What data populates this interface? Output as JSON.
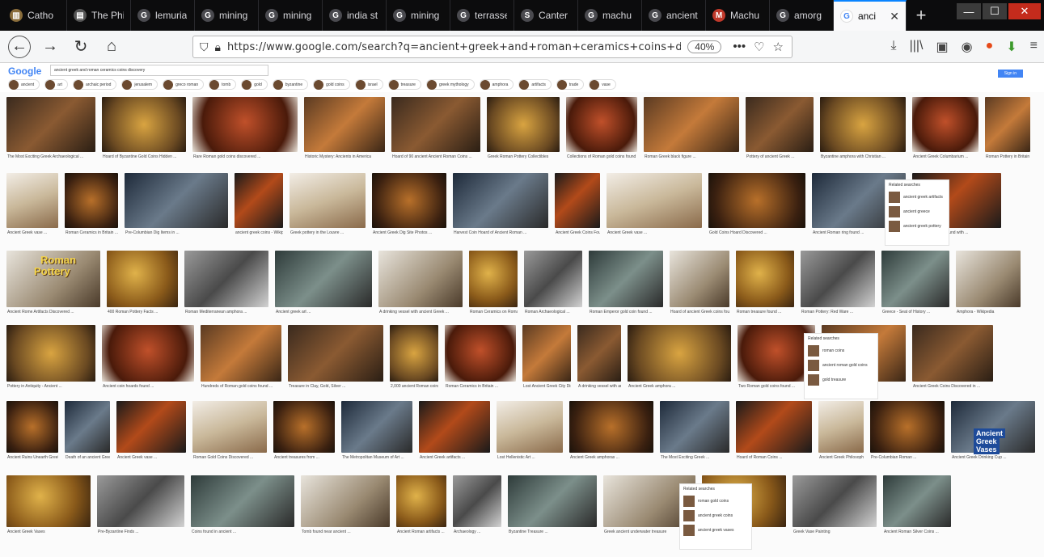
{
  "browser": {
    "tabs": [
      {
        "title": "Catho",
        "icon": "library-icon",
        "color": "#8a6d3b",
        "glyph": "▥"
      },
      {
        "title": "The Phi",
        "icon": "page-icon",
        "color": "#555555",
        "glyph": "▤"
      },
      {
        "title": "lemuria",
        "icon": "google-icon",
        "color": "#4a4a4f",
        "glyph": "G"
      },
      {
        "title": "mining",
        "icon": "google-icon",
        "color": "#4a4a4f",
        "glyph": "G"
      },
      {
        "title": "mining",
        "icon": "google-icon",
        "color": "#4a4a4f",
        "glyph": "G"
      },
      {
        "title": "india st",
        "icon": "google-icon",
        "color": "#4a4a4f",
        "glyph": "G"
      },
      {
        "title": "mining",
        "icon": "google-icon",
        "color": "#4a4a4f",
        "glyph": "G"
      },
      {
        "title": "terrasse",
        "icon": "google-icon",
        "color": "#4a4a4f",
        "glyph": "G"
      },
      {
        "title": "Canter",
        "icon": "s-icon",
        "color": "#4a4a4f",
        "glyph": "S"
      },
      {
        "title": "machu",
        "icon": "google-icon",
        "color": "#4a4a4f",
        "glyph": "G"
      },
      {
        "title": "ancient",
        "icon": "google-icon",
        "color": "#4a4a4f",
        "glyph": "G"
      },
      {
        "title": "Machu",
        "icon": "site-icon",
        "color": "#c0392b",
        "glyph": "M"
      },
      {
        "title": "amorg",
        "icon": "google-icon",
        "color": "#4a4a4f",
        "glyph": "G"
      }
    ],
    "active_tab": {
      "title": "anci",
      "icon": "google-icon"
    },
    "new_tab_label": "+",
    "url": "https://www.google.com/search?q=ancient+greek+and+roman+ceramics+coins+dis",
    "zoom": "40%"
  },
  "google": {
    "logo": "Google",
    "query": "ancient greek and roman ceramics coins discovery",
    "signin": "Sign in",
    "chips": [
      "ancient",
      "art",
      "archaic period",
      "jerusalem",
      "greco roman",
      "tomb",
      "gold",
      "byzantine",
      "gold coins",
      "israel",
      "treasure",
      "greek mythology",
      "amphora",
      "artifacts",
      "trade",
      "vase"
    ]
  },
  "results": {
    "captions": [
      "The Most Exciting Greek Archaeological ...",
      "Hoard of Byzantine Gold Coins Hidden ...",
      "Rare Roman gold coins discovered ...",
      "Historic Mystery: Ancients in America",
      "Hoard of 90 ancient Ancient Roman Coins ...",
      "Greek Roman Pottery Collectibles",
      "Collections of Roman gold coins found in ...",
      "Roman Greek black figure ...",
      "Pottery of ancient Greek ...",
      "Byzantine amphora with Christian ...",
      "Ancient Greek Columbarium ...",
      "Roman Pottery in Britain ...",
      "Ancient Greek vase ...",
      "Roman Ceramics in Britain ...",
      "Pre-Columbian Dig Items in ...",
      "ancient greek coins - Wikipedia",
      "Greek pottery in the Louvre ...",
      "Ancient Greek Dig Site Photos ...",
      "Harvest Coin Hoard of Ancient Roman ...",
      "Ancient Greek Coins Found ...",
      "Ancient Greek vase ...",
      "Gold Coins Hoard Discovered ...",
      "Ancient Roman ring found ...",
      "Gold Roman coin found with ...",
      "Ancient Rome Artifacts Discovered ...",
      "400 Roman Pottery Facts ...",
      "Roman Mediterranean amphora ...",
      "Ancient greek art ...",
      "A drinking vessel with ancient Greek ...",
      "Roman Ceramics on Roman Ceramics ...",
      "Roman Archaeological ...",
      "Roman Emperor gold coin found ...",
      "Hoard of ancient Greek coins found ...",
      "Roman treasure found ...",
      "Roman Pottery: Red Ware ...",
      "Greece - Seat of History ...",
      "Amphora - Wikipedia",
      "Pottery in Antiquity - Ancient ...",
      "Ancient coin hoards found ...",
      "Hundreds of Roman gold coins found ...",
      "Treasure in Clay, Gold, Silver ...",
      "2,000 ancient Roman coins discovered ...",
      "Roman Ceramics in Britain ...",
      "Lost Ancient Greek City Discovered ...",
      "A drinking vessel with ancient ...",
      "Ancient Greek amphora ...",
      "Two Roman gold coins found ...",
      "Pottery of ancient Greece ...",
      "Ancient Greek Coins Discovered in ...",
      "Ancient Ruins Unearth Greek ...",
      "Death of an ancient Greek ...",
      "Ancient Greek vase ...",
      "Roman Gold Coins Discovered ...",
      "Ancient treasures from ...",
      "The Metropolitan Museum of Art ...",
      "Ancient Greek artifacts ...",
      "Lost Hellenistic Art ...",
      "Ancient Greek amphoras ...",
      "The Most Exciting Greek ...",
      "Hoard of Roman Coins ...",
      "Ancient Greek Philosophy ...",
      "Pre-Columbian Roman ...",
      "Ancient Greek Drinking Cup ...",
      "Ancient Greek Vases",
      "Pre-Byzantine Finds ...",
      "Coins found in ancient ...",
      "Tomb found near ancient ...",
      "Ancient Roman artifacts ...",
      "Archaeology ...",
      "Byzantine Treasure ...",
      "Greek ancient underwater treasure",
      "6th Century Greek Coins ...",
      "Greek Vase Painting",
      "Ancient Roman Silver Coins ...",
      "Ancient Greek Pottery ...",
      "Ancient Greek Vases ..."
    ],
    "overlay_roman": "Roman",
    "overlay_pottery": "Pottery",
    "overlay_ancient": "Ancient",
    "overlay_greek": "Greek",
    "overlay_vases": "Vases",
    "related_1": {
      "title": "Related searches",
      "items": [
        "ancient greek artifacts",
        "ancient greece",
        "ancient greek pottery"
      ]
    },
    "related_2": {
      "title": "Related searches",
      "items": [
        "roman coins",
        "ancient roman gold coins",
        "gold treasure"
      ]
    },
    "related_3": {
      "title": "Related searches",
      "items": [
        "roman gold coins",
        "ancient greek coins",
        "ancient greek vases"
      ]
    }
  }
}
